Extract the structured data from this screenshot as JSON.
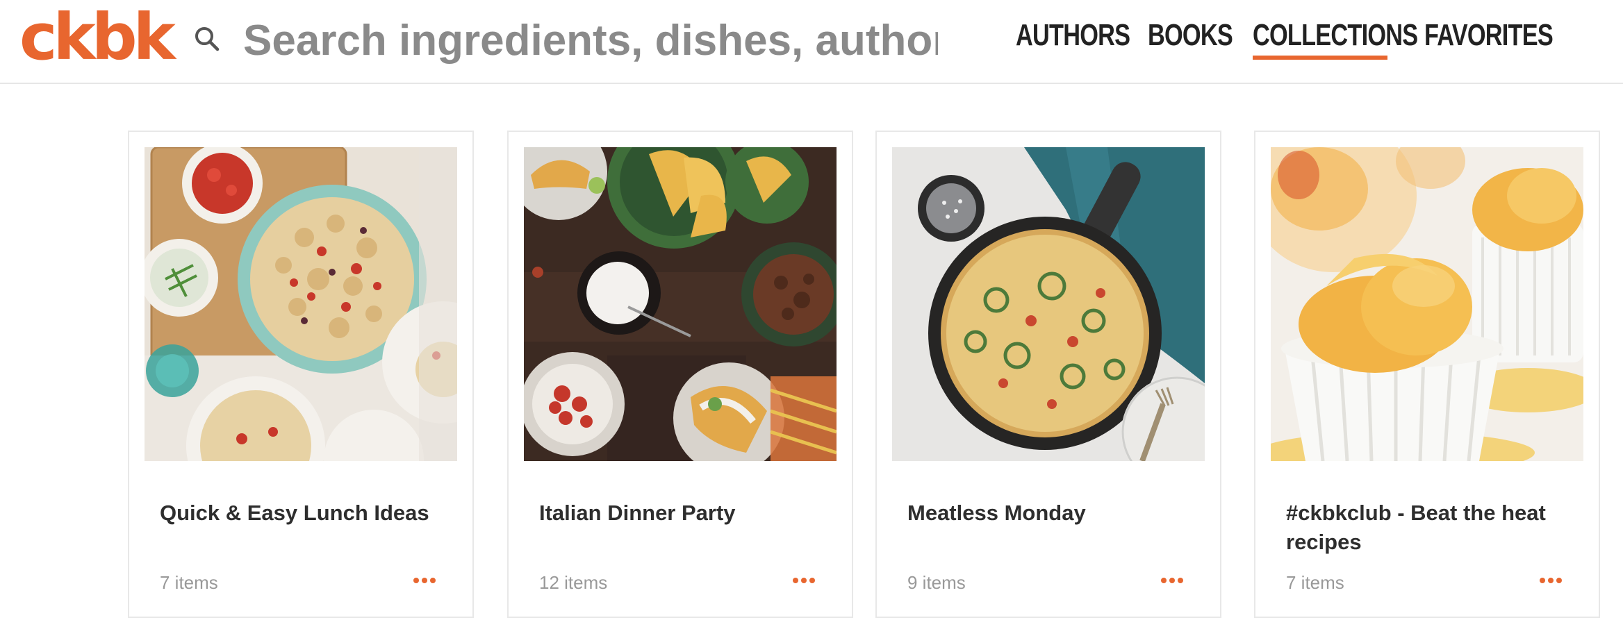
{
  "brand": {
    "logo_text": "ckbk",
    "accent_color": "#e8662f"
  },
  "search": {
    "placeholder": "Search ingredients, dishes, authors,",
    "icon": "search-icon"
  },
  "nav": {
    "items": [
      {
        "label": "AUTHORS",
        "active": false
      },
      {
        "label": "BOOKS",
        "active": false
      },
      {
        "label": "COLLECTIONS",
        "active": true
      },
      {
        "label": "FAVORITES",
        "active": false
      }
    ]
  },
  "collections": [
    {
      "title": "Quick & Easy Lunch Ideas",
      "count": "7 items",
      "image": "pasta-salad-photo"
    },
    {
      "title": "Italian Dinner Party",
      "count": "12 items",
      "image": "tacos-photo"
    },
    {
      "title": "Meatless Monday",
      "count": "9 items",
      "image": "frittata-skillet-photo"
    },
    {
      "title": "#ckbkclub - Beat the heat recipes",
      "count": "7 items",
      "image": "peach-sorbet-photo"
    }
  ]
}
